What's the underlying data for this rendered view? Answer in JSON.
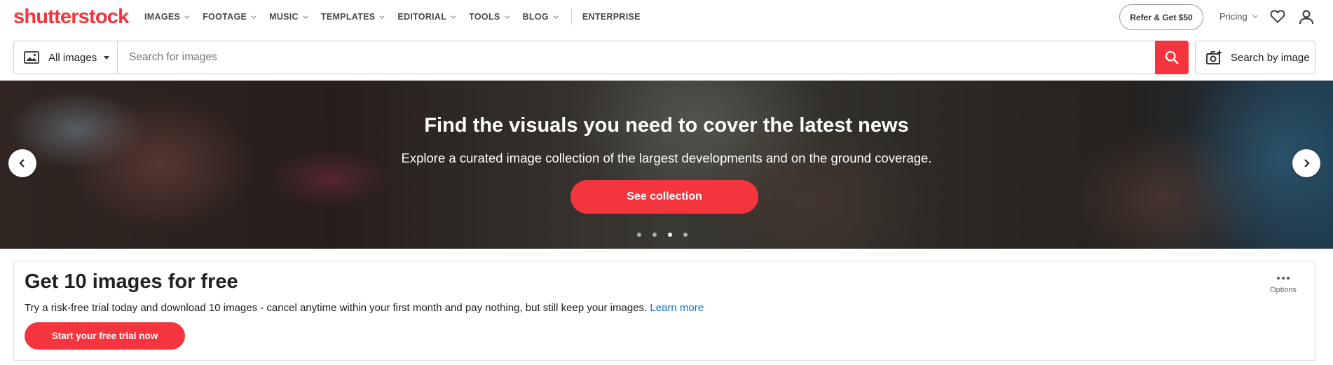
{
  "brand": {
    "logo_text": "shutterstock",
    "accent_color": "#f5353d",
    "link_color": "#0c6fcd"
  },
  "nav": {
    "items": [
      {
        "label": "IMAGES",
        "has_dropdown": true
      },
      {
        "label": "FOOTAGE",
        "has_dropdown": true
      },
      {
        "label": "MUSIC",
        "has_dropdown": true
      },
      {
        "label": "TEMPLATES",
        "has_dropdown": true
      },
      {
        "label": "EDITORIAL",
        "has_dropdown": true
      },
      {
        "label": "TOOLS",
        "has_dropdown": true
      },
      {
        "label": "BLOG",
        "has_dropdown": true
      }
    ],
    "enterprise_label": "ENTERPRISE",
    "refer_label": "Refer & Get $50",
    "pricing_label": "Pricing",
    "icons": [
      "heart-icon",
      "user-icon"
    ]
  },
  "search": {
    "type_selected": "All images",
    "placeholder": "Search for images",
    "value": "",
    "search_by_image_label": "Search by image",
    "icons": [
      "image-icon",
      "search-icon",
      "camera-icon"
    ]
  },
  "hero": {
    "title": "Find the visuals you need to cover the latest news",
    "subtitle": "Explore a curated image collection of the largest developments and on the ground coverage.",
    "cta_label": "See collection",
    "slide_count": 4,
    "active_slide": 3
  },
  "promo": {
    "title": "Get 10 images for free",
    "text": "Try a risk-free trial today and download 10 images - cancel anytime within your first month and pay nothing, but still keep your images.",
    "link_label": "Learn more",
    "button_label": "Start your free trial now",
    "options_label": "Options"
  }
}
